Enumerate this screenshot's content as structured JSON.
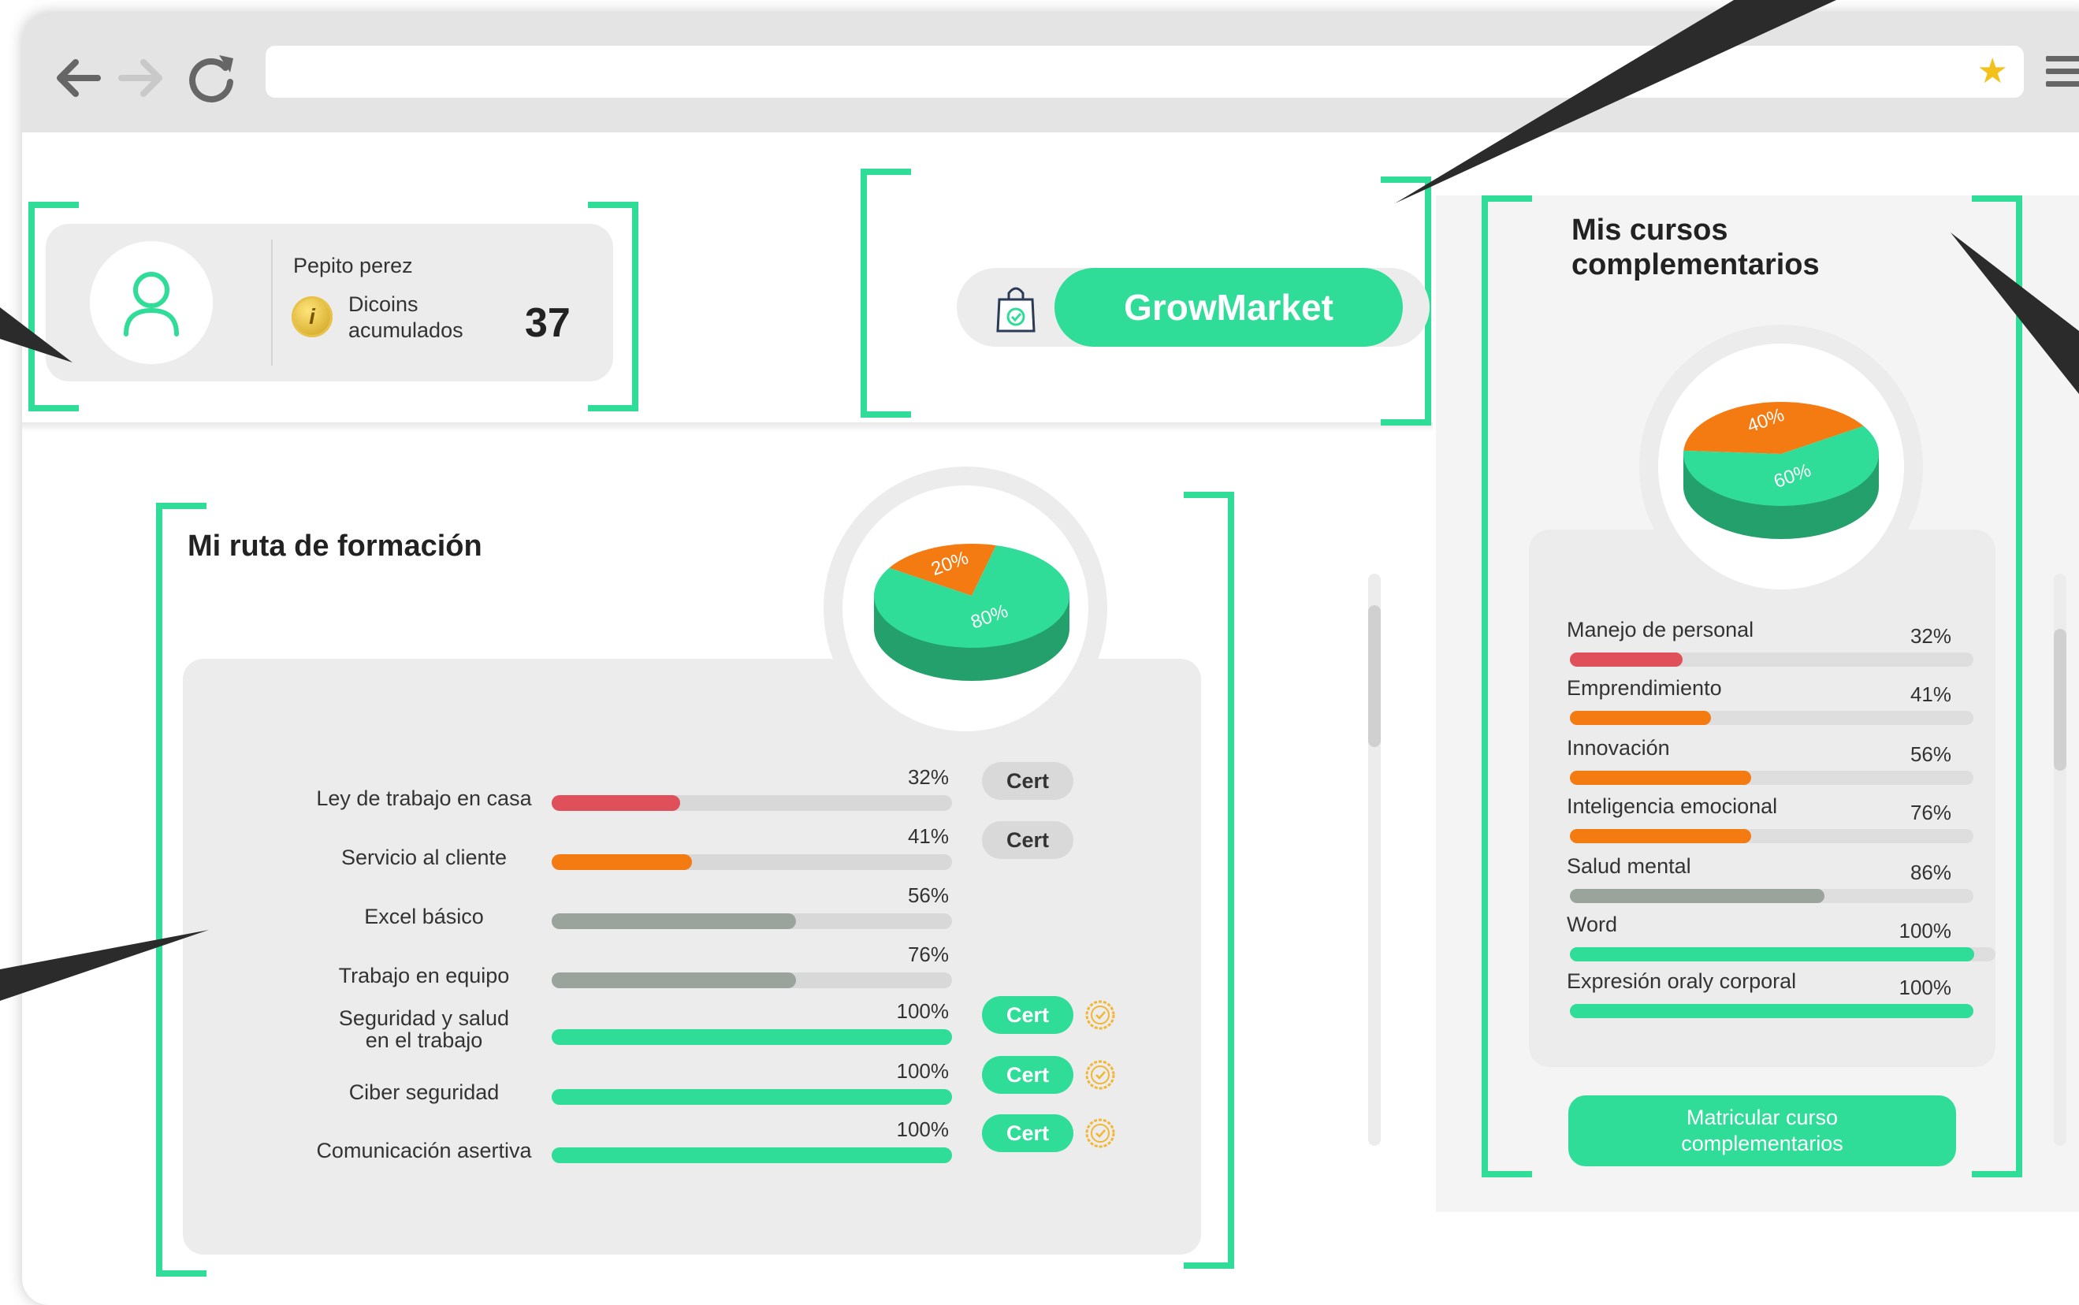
{
  "browser": {
    "back_icon": "arrow-left-icon",
    "forward_icon": "arrow-right-icon",
    "reload_icon": "reload-icon",
    "url": "",
    "bookmark_icon": "star-icon",
    "menu_icon": "hamburger-menu-icon"
  },
  "profile": {
    "name": "Pepito perez",
    "coins_label": "Dicoins acumulados",
    "coins_label_line1": "Dicoins",
    "coins_label_line2": "acumulados",
    "coins_value": "37"
  },
  "market": {
    "button_label": "GrowMarket",
    "icon": "shopping-bag-icon"
  },
  "route": {
    "title": "Mi ruta de formación",
    "pie": {
      "segments": [
        {
          "label": "20%",
          "value": 20,
          "color": "#f47a12"
        },
        {
          "label": "80%",
          "value": 80,
          "color": "#2fdc98"
        }
      ]
    },
    "courses": [
      {
        "name_line1": "Ley de trabajo en casa",
        "name_line2": "",
        "percent": "32%",
        "value": 32,
        "color": "#e0505a",
        "cert": "Cert",
        "cert_style": "gray",
        "medal": false
      },
      {
        "name_line1": "Servicio al cliente",
        "name_line2": "",
        "percent": "41%",
        "value": 35,
        "color": "#f47a12",
        "cert": "Cert",
        "cert_style": "gray",
        "medal": false
      },
      {
        "name_line1": "Excel básico",
        "name_line2": "",
        "percent": "56%",
        "value": 61,
        "color": "#9aa49d",
        "cert": "",
        "cert_style": "",
        "medal": false
      },
      {
        "name_line1": "Trabajo en equipo",
        "name_line2": "",
        "percent": "76%",
        "value": 61,
        "color": "#9aa49d",
        "cert": "",
        "cert_style": "",
        "medal": false
      },
      {
        "name_line1": "Seguridad y salud",
        "name_line2": "en el trabajo",
        "percent": "100%",
        "value": 100,
        "color": "#2fdc98",
        "cert": "Cert",
        "cert_style": "green",
        "medal": true
      },
      {
        "name_line1": "Ciber seguridad",
        "name_line2": "",
        "percent": "100%",
        "value": 100,
        "color": "#2fdc98",
        "cert": "Cert",
        "cert_style": "green",
        "medal": true
      },
      {
        "name_line1": "Comunicación asertiva",
        "name_line2": "",
        "percent": "100%",
        "value": 100,
        "color": "#2fdc98",
        "cert": "Cert",
        "cert_style": "green",
        "medal": true
      }
    ]
  },
  "complementary": {
    "title_line1": "Mis cursos",
    "title_line2": "complementarios",
    "pie": {
      "segments": [
        {
          "label": "40%",
          "value": 40,
          "color": "#f47a12"
        },
        {
          "label": "60%",
          "value": 60,
          "color": "#2fdc98"
        }
      ]
    },
    "courses": [
      {
        "name": "Manejo de personal",
        "percent": "32%",
        "value": 28,
        "color": "#e0505a"
      },
      {
        "name": "Emprendimiento",
        "percent": "41%",
        "value": 35,
        "color": "#f47a12"
      },
      {
        "name": "Innovación",
        "percent": "56%",
        "value": 45,
        "color": "#f47a12"
      },
      {
        "name": "Inteligencia emocional",
        "percent": "76%",
        "value": 45,
        "color": "#f47a12"
      },
      {
        "name": "Salud mental",
        "percent": "86%",
        "value": 63,
        "color": "#9aa49d"
      },
      {
        "name": "Word",
        "percent": "100%",
        "value": 95,
        "color": "#2fdc98"
      },
      {
        "name": "Expresión oraly corporal",
        "percent": "100%",
        "value": 100,
        "color": "#2fdc98"
      }
    ],
    "enroll_button_line1": "Matricular curso",
    "enroll_button_line2": "complementarios"
  }
}
